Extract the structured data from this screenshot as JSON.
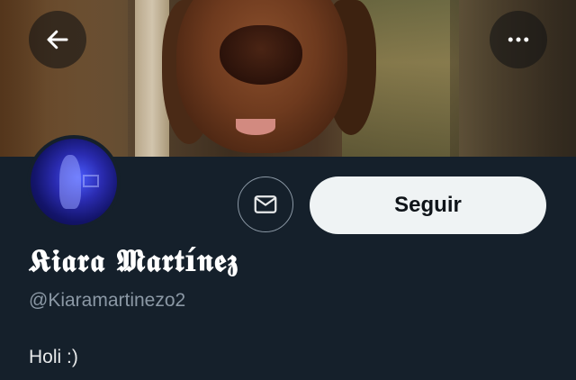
{
  "profile": {
    "display_name": "𝕶𝖎𝖆𝖗𝖆 𝕸𝖆𝖗𝖙í𝖓𝖊𝖟",
    "handle": "@Kiaramartinezo2",
    "bio": "Holi :)"
  },
  "actions": {
    "follow_label": "Seguir"
  },
  "icons": {
    "back": "arrow-left-icon",
    "more": "more-horizontal-icon",
    "message": "envelope-icon"
  },
  "colors": {
    "background": "#15202b",
    "follow_button_bg": "#eff3f4",
    "secondary_text": "#8b98a5"
  }
}
